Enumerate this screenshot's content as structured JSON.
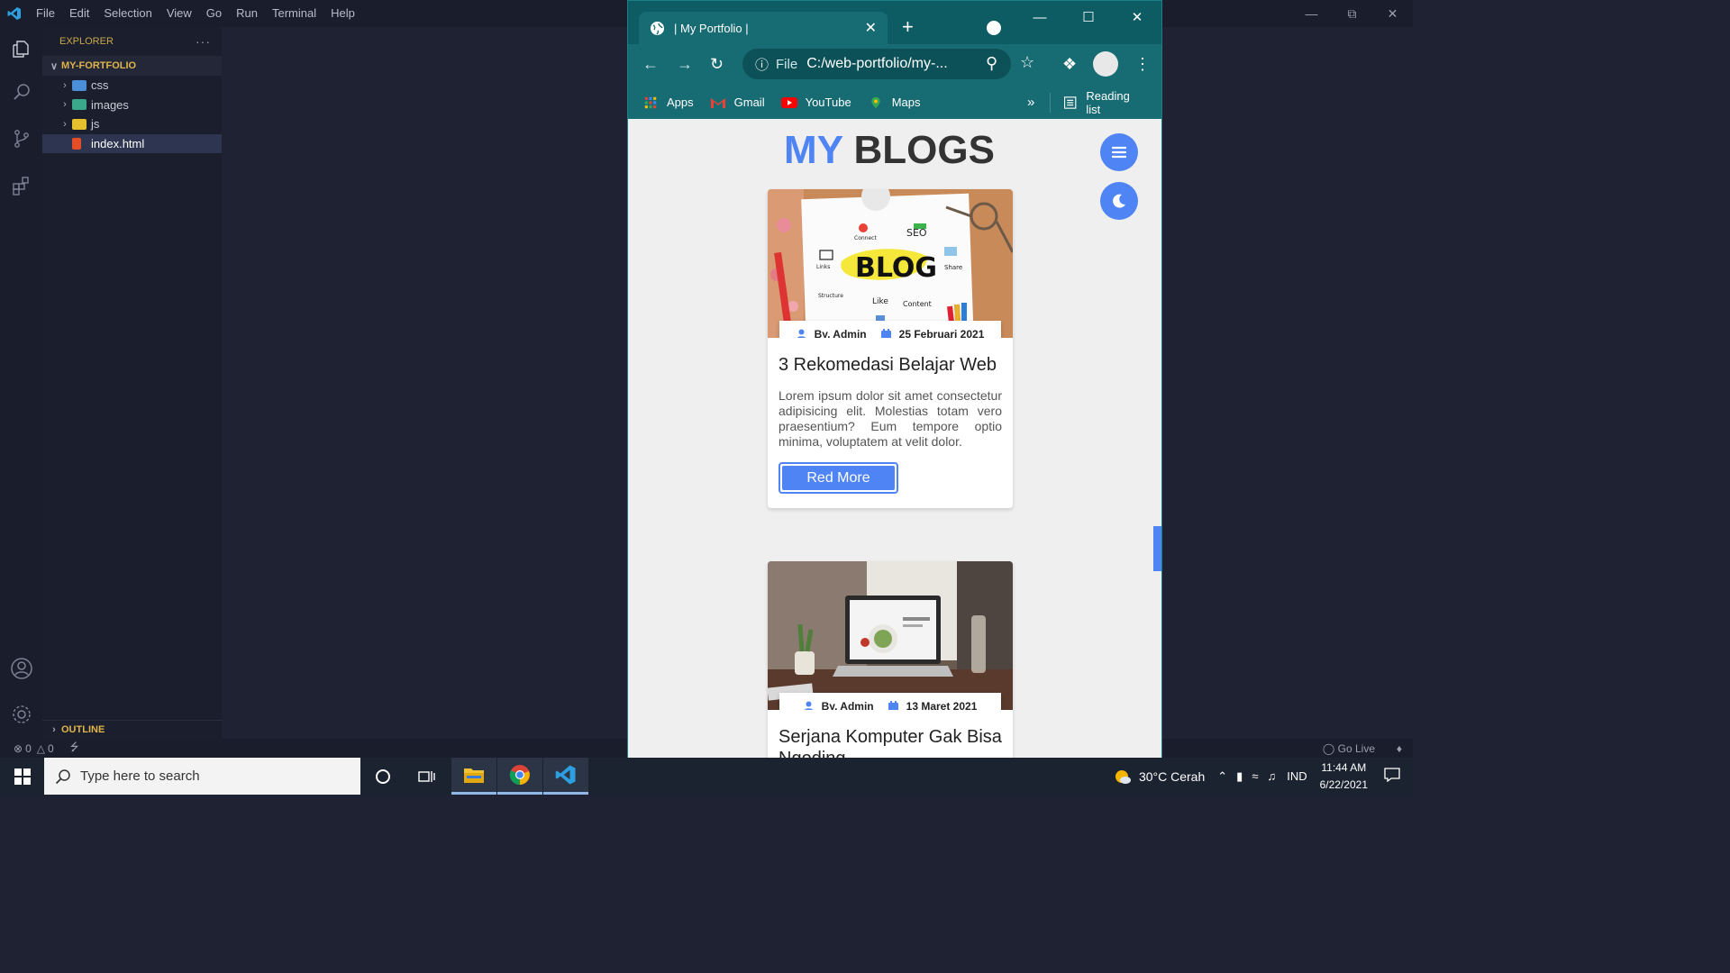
{
  "vscode": {
    "menu": [
      "File",
      "Edit",
      "Selection",
      "View",
      "Go",
      "Run",
      "Terminal",
      "Help"
    ],
    "explorer_title": "EXPLORER",
    "explorer_more": "···",
    "project": "MY-FORTFOLIO",
    "files": [
      {
        "name": "css",
        "type": "folder"
      },
      {
        "name": "images",
        "type": "folder"
      },
      {
        "name": "js",
        "type": "folder"
      },
      {
        "name": "index.html",
        "type": "file"
      }
    ],
    "outline": "OUTLINE",
    "status": {
      "errors": "0",
      "warnings": "0",
      "go_live": "Go Live"
    }
  },
  "browser": {
    "tab_title": "| My Portfolio |",
    "url_scheme": "File",
    "url": "C:/web-portfolio/my-...",
    "bookmarks": [
      "Apps",
      "Gmail",
      "YouTube",
      "Maps"
    ],
    "bookmarks_overflow": "»",
    "reading_list": "Reading list"
  },
  "page": {
    "title_accent": "MY",
    "title_rest": "BLOGS",
    "posts": [
      {
        "author": "By, Admin",
        "date": "25 Februari 2021",
        "title": "3 Rekomedasi Belajar Web",
        "excerpt": "Lorem ipsum dolor sit amet consectetur adipisicing elit. Molestias totam vero praesentium? Eum tempore optio minima, voluptatem at velit dolor.",
        "button": "Red More",
        "image_words": {
          "main": "BLOG",
          "seo": "SEO",
          "connect": "Connect",
          "links": "Links",
          "share": "Share",
          "structure": "Structure",
          "like": "Like",
          "content": "Content"
        }
      },
      {
        "author": "By, Admin",
        "date": "13 Maret 2021",
        "title": "Serjana Komputer Gak Bisa Ngoding"
      }
    ]
  },
  "taskbar": {
    "search_placeholder": "Type here to search",
    "weather": "30°C  Cerah",
    "lang": "IND",
    "time": "11:44 AM",
    "date": "6/22/2021"
  },
  "colors": {
    "accent": "#4f84f4",
    "browser_frame": "#0d5c63",
    "vscode_bg": "#1f2233"
  }
}
